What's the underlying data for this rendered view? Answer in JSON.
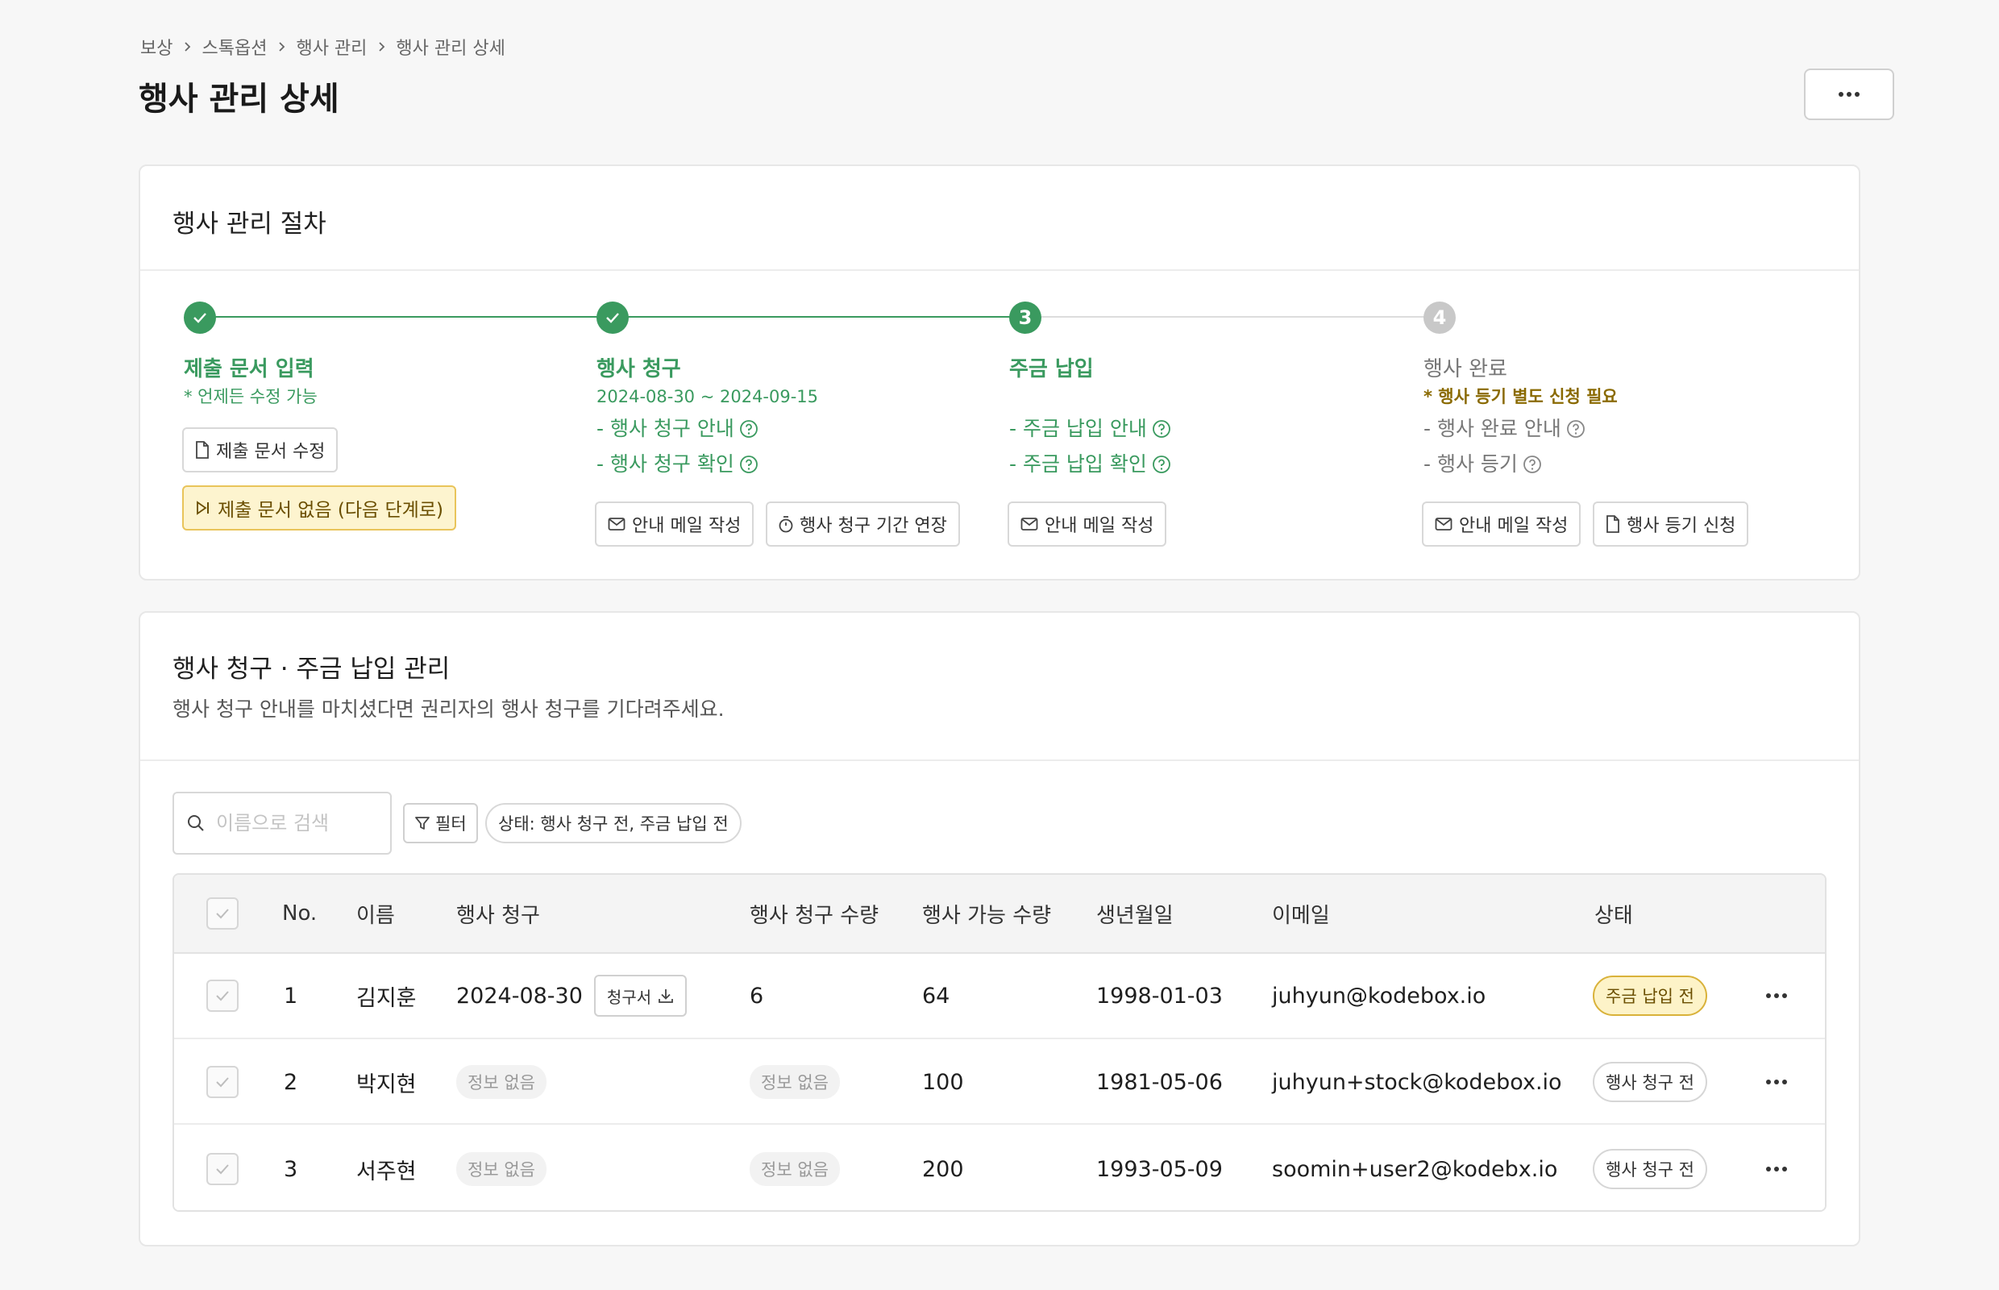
{
  "breadcrumb": [
    "보상",
    "스톡옵션",
    "행사 관리",
    "행사 관리 상세"
  ],
  "page_title": "행사 관리 상세",
  "procedure": {
    "title": "행사 관리 절차",
    "steps": [
      {
        "number": "1",
        "status": "done",
        "name": "제출 문서 입력",
        "sub": "* 언제든 수정 가능",
        "buttons": [
          "제출 문서 수정",
          "제출 문서 없음 (다음 단계로)"
        ]
      },
      {
        "number": "2",
        "status": "done",
        "name": "행사 청구",
        "sub": "2024-08-30 ~ 2024-09-15",
        "links": [
          "- 행사 청구 안내",
          "- 행사 청구 확인"
        ],
        "buttons": [
          "안내 메일 작성",
          "행사 청구 기간 연장"
        ]
      },
      {
        "number": "3",
        "status": "current",
        "name": "주금 납입",
        "links": [
          "- 주금 납입 안내",
          "- 주금 납입 확인"
        ],
        "buttons": [
          "안내 메일 작성"
        ]
      },
      {
        "number": "4",
        "status": "pending",
        "name": "행사 완료",
        "sub": "* 행사 등기 별도 신청 필요",
        "links": [
          "- 행사 완료 안내",
          "- 행사 등기"
        ],
        "buttons": [
          "안내 메일 작성",
          "행사 등기 신청"
        ]
      }
    ]
  },
  "management": {
    "title": "행사 청구 · 주금 납입 관리",
    "description": "행사 청구 안내를 마치셨다면 권리자의 행사 청구를 기다려주세요.",
    "search_placeholder": "이름으로 검색",
    "filter_label": "필터",
    "status_filter": "상태: 행사 청구 전, 주금 납입 전",
    "columns": [
      "No.",
      "이름",
      "행사 청구",
      "행사 청구 수량",
      "행사 가능 수량",
      "생년월일",
      "이메일",
      "상태"
    ],
    "rows": [
      {
        "no": "1",
        "name": "김지훈",
        "claim_date": "2024-08-30",
        "claim_doc": "청구서",
        "claim_qty": "6",
        "avail_qty": "64",
        "birth": "1998-01-03",
        "email": "juhyun@kodebox.io",
        "status": "주금 납입 전"
      },
      {
        "no": "2",
        "name": "박지현",
        "claim_date": "정보 없음",
        "claim_qty": "정보 없음",
        "avail_qty": "100",
        "birth": "1981-05-06",
        "email": "juhyun+stock@kodebox.io",
        "status": "행사 청구 전"
      },
      {
        "no": "3",
        "name": "서주현",
        "claim_date": "정보 없음",
        "claim_qty": "정보 없음",
        "avail_qty": "200",
        "birth": "1993-05-09",
        "email": "soomin+user2@kodebx.io",
        "status": "행사 청구 전"
      }
    ]
  },
  "colors": {
    "green": "#3a9a5f",
    "gray_step": "#c8c8c8",
    "warning_bg": "#fdf4cf",
    "warning_border": "#e9c45a",
    "badge_yellow_border": "#d9b23a",
    "brown_text": "#8a6a00"
  },
  "icons": [
    "chevron-right-icon",
    "more-horizontal-icon",
    "check-icon",
    "file-icon",
    "skip-forward-icon",
    "help-circle-icon",
    "mail-icon",
    "stopwatch-icon",
    "search-icon",
    "filter-icon",
    "download-icon"
  ]
}
